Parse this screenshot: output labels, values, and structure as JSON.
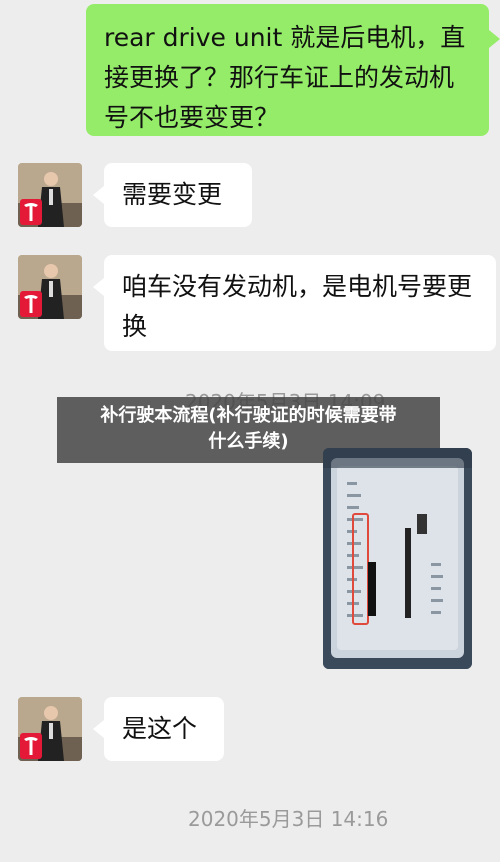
{
  "chat": {
    "msg_sent_1": "rear drive unit 就是后电机，直接更换了？那行车证上的发动机号不也要变更？",
    "msg_recv_1": "需要变更",
    "msg_recv_2": "咱车没有发动机，是电机号要更换",
    "overlapped_timestamp": "2020年5月3日 14:09",
    "msg_recv_3": "是这个",
    "timestamp_bottom": "2020年5月3日 14:16"
  },
  "banner": {
    "line1": "补行驶本流程(补行驶证的时候需要带",
    "line2": "什么手续)"
  },
  "icons": {
    "avatar": "tesla-avatar-icon",
    "logo": "tesla-logo-icon"
  },
  "colors": {
    "sent_bubble": "#95ec69",
    "received_bubble": "#ffffff",
    "background": "#ededed"
  }
}
